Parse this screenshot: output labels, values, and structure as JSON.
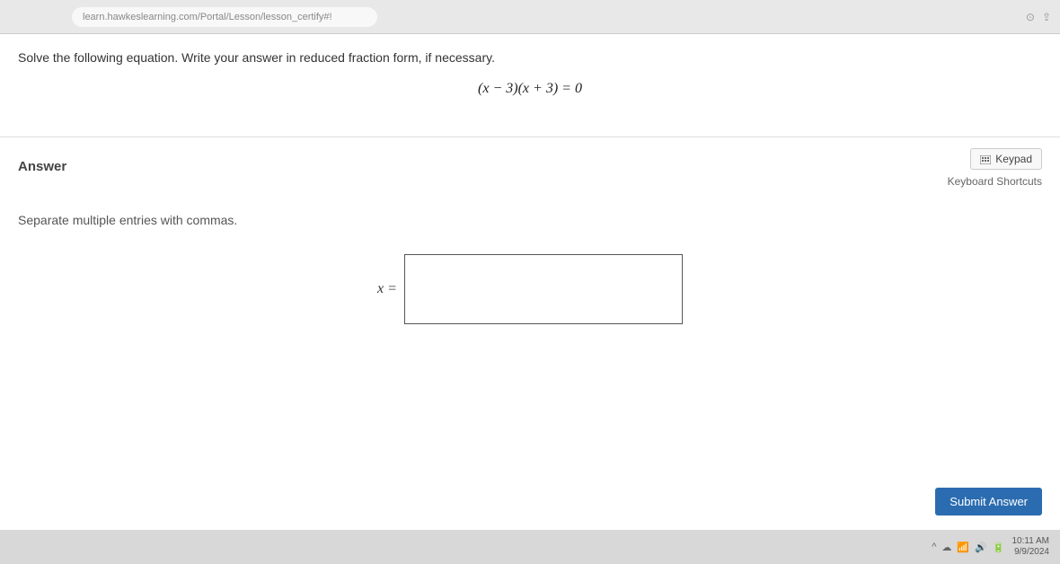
{
  "browser": {
    "url": "learn.hawkeslearning.com/Portal/Lesson/lesson_certify#!"
  },
  "question": {
    "prompt": "Solve the following equation. Write your answer in reduced fraction form, if necessary.",
    "equation_left": "(x − 3)(x + 3) = 0"
  },
  "answer": {
    "section_label": "Answer",
    "keypad_label": "Keypad",
    "shortcuts_label": "Keyboard Shortcuts",
    "hint": "Separate multiple entries with commas.",
    "variable_label": "x =",
    "input_value": ""
  },
  "actions": {
    "submit_label": "Submit Answer"
  },
  "taskbar": {
    "time": "10:11 AM",
    "date": "9/9/2024"
  }
}
